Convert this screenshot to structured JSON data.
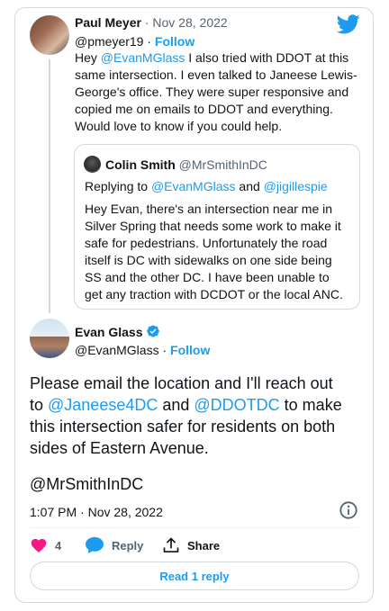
{
  "tweet1": {
    "name": "Paul Meyer",
    "sep": "·",
    "date": "Nov 28, 2022",
    "handle": "@pmeyer19",
    "dot": "·",
    "follow": "Follow",
    "mention": "@EvanMGlass",
    "lines": [
      " I also tried with DDOT at this",
      "same intersection. I even talked to Janeese Lewis-",
      "George's office. They were super responsive and",
      "copied me on emails to DDOT and everything.",
      "Would love to know if you could help."
    ],
    "prefix": "Hey "
  },
  "quote": {
    "name": "Colin Smith",
    "handle": "@MrSmithInDC",
    "reply_prefix": "Replying to ",
    "reply_to_1": "@EvanMGlass",
    "reply_and": " and ",
    "reply_to_2": "@jigillespie",
    "lines": [
      "Hey Evan, there's an intersection near me in",
      "Silver Spring that needs some work to make it",
      "safe for pedestrians. Unfortunately the road",
      "itself is DC with sidewalks on one side being",
      "SS and the other DC. I have been unable to",
      "get any traction with DCDOT or the local ANC."
    ]
  },
  "main": {
    "name": "Evan Glass",
    "handle": "@EvanMGlass",
    "dot": "·",
    "follow": "Follow",
    "line1": "Please email the location and I'll reach out",
    "line2_pre": "to ",
    "mention1": "@Janeese4DC",
    "line2_mid": " and ",
    "mention2": "@DDOTDC",
    "line2_post": " to make",
    "line3": "this intersection safer for residents on both",
    "line4": "sides of Eastern Avenue.",
    "mention3": "@MrSmithInDC",
    "timestamp": "1:07 PM · Nov 28, 2022"
  },
  "actions": {
    "like_count": "4",
    "reply_label": "Reply",
    "share_label": "Share",
    "read_replies": "Read 1 reply"
  },
  "colors": {
    "accent": "#1d9bf0",
    "like": "#f91880",
    "text": "#0f1419",
    "muted": "#536471"
  }
}
